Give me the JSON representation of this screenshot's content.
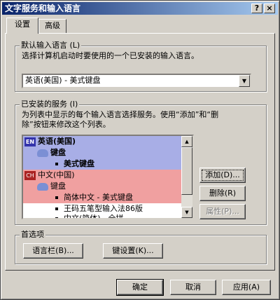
{
  "window": {
    "title": "文字服务和输入语言"
  },
  "titlebar": {
    "help_label": "?",
    "close_label": "×"
  },
  "tabs": [
    {
      "label": "设置",
      "active": true
    },
    {
      "label": "高级",
      "active": false
    }
  ],
  "default_language": {
    "legend": "默认输入语言 (L)",
    "description": "选择计算机启动时要使用的一个已安装的输入语言。",
    "selected": "英语(美国) - 美式键盘"
  },
  "installed_services": {
    "legend": "已安装的服务 (I)",
    "description_line1": "为列表中显示的每个输入语言选择服务。使用“添加”和“删",
    "description_line2": "除”按钮来修改这个列表。",
    "tree": [
      {
        "kind": "language",
        "badge": "EN",
        "label": "英语(美国)",
        "bold": true
      },
      {
        "kind": "category",
        "label": "键盘",
        "bold": true
      },
      {
        "kind": "item",
        "label": "美式键盘",
        "bold": true
      },
      {
        "kind": "language",
        "badge": "CH",
        "label": "中文(中国)",
        "bold": false
      },
      {
        "kind": "category",
        "label": "键盘",
        "bold": false
      },
      {
        "kind": "item",
        "label": "简体中文 - 美式键盘",
        "bold": false
      },
      {
        "kind": "item",
        "label": "王码五笔型输入法86版",
        "bold": false
      },
      {
        "kind": "item",
        "label": "中文(简体) - 全拼",
        "bold": false
      }
    ],
    "add_label": "添加(D)...",
    "remove_label": "删除(R)",
    "properties_label": "属性(P)..."
  },
  "preferences": {
    "legend": "首选项",
    "language_bar_label": "语言栏(B)...",
    "key_settings_label": "键设置(K)..."
  },
  "footer": {
    "ok_label": "确定",
    "cancel_label": "取消",
    "apply_label": "应用(A)"
  },
  "colors": {
    "en_highlight": "#a8aee6",
    "ch_highlight": "#f0a0a0",
    "en_badge": "#3333aa",
    "ch_badge": "#aa2222"
  }
}
